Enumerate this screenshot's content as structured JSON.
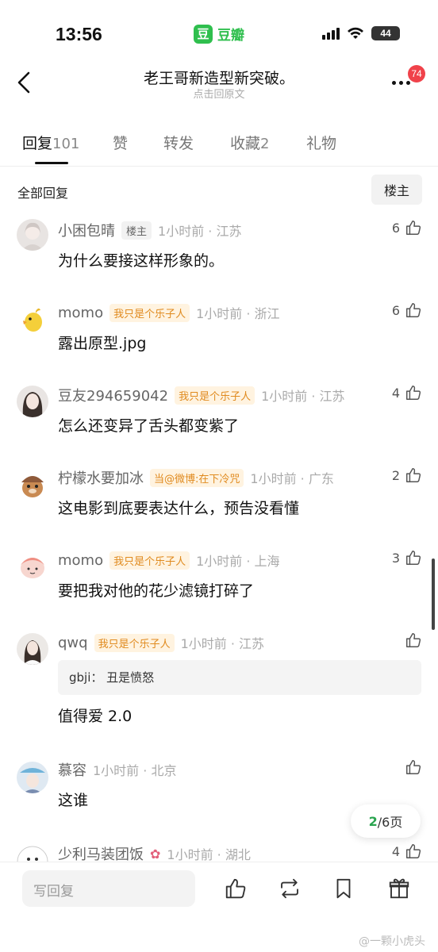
{
  "status": {
    "time": "13:56",
    "app_logo": "豆",
    "app_name": "豆瓣",
    "battery": "44"
  },
  "nav": {
    "title": "老王哥新造型新突破。",
    "subtitle": "点击回原文",
    "badge": "74"
  },
  "tabs": [
    {
      "label": "回复",
      "count": "101"
    },
    {
      "label": "赞",
      "count": ""
    },
    {
      "label": "转发",
      "count": ""
    },
    {
      "label": "收藏",
      "count": "2"
    },
    {
      "label": "礼物",
      "count": ""
    }
  ],
  "section": {
    "title": "全部回复",
    "filter_label": "楼主"
  },
  "comments": [
    {
      "name": "小困包晴",
      "tag": "楼主",
      "meta": "1小时前 · 江苏",
      "text": "为什么要接这样形象的。",
      "likes": "6"
    },
    {
      "name": "momo",
      "tag": "我只是个乐子人",
      "meta": "1小时前 · 浙江",
      "text": "露出原型.jpg",
      "likes": "6"
    },
    {
      "name": "豆友294659042",
      "tag": "我只是个乐子人",
      "meta": "1小时前 · 江苏",
      "text": "怎么还变异了舌头都变紫了",
      "likes": "4"
    },
    {
      "name": "柠檬水要加冰",
      "tag": "当@微博:在下冷咒",
      "meta": "1小时前 · 广东",
      "text": "这电影到底要表达什么，预告没看懂",
      "likes": "2"
    },
    {
      "name": "momo",
      "tag": "我只是个乐子人",
      "meta": "1小时前 · 上海",
      "text": "要把我对他的花少滤镜打碎了",
      "likes": "3"
    },
    {
      "name": "qwq",
      "tag": "我只是个乐子人",
      "meta": "1小时前 · 江苏",
      "quote": "gbji： 丑是愤怒",
      "text": "值得爱 2.0",
      "likes": ""
    },
    {
      "name": "慕容",
      "tag": "",
      "meta": "1小时前 · 北京",
      "text": "这谁",
      "likes": ""
    },
    {
      "name": "少利马装团饭",
      "tag": "",
      "meta": "1小时前 · 湖北",
      "text": "",
      "likes": "4"
    }
  ],
  "pager": {
    "current": "2",
    "total": "/6页"
  },
  "bottom": {
    "reply_placeholder": "写回复"
  },
  "watermark": "@一颗小虎头",
  "colors": {
    "accent": "#2fbf4e",
    "badge": "#f0424a",
    "fan_tag": "#e08a1e"
  }
}
